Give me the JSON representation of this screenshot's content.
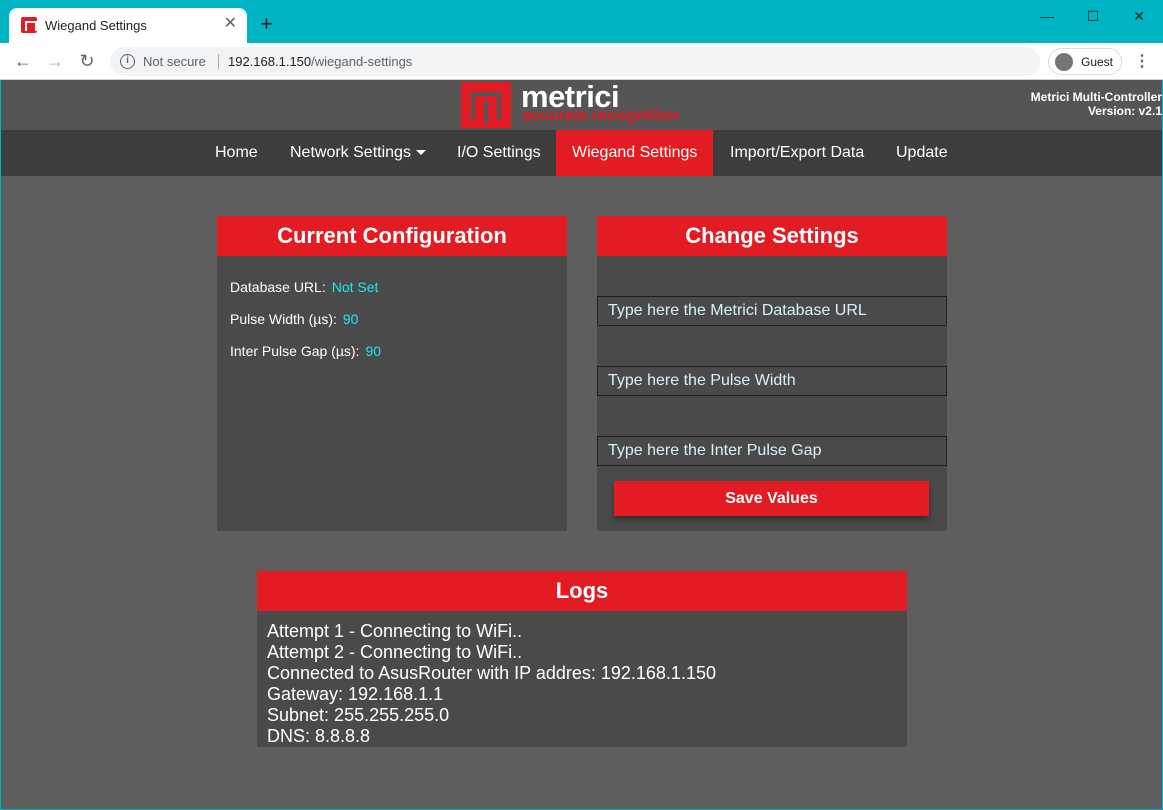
{
  "browser": {
    "tab_title": "Wiegand Settings",
    "new_tab_symbol": "+",
    "close_symbol": "✕",
    "security_label": "Not secure",
    "url_host": "192.168.1.150",
    "url_path": "/wiegand-settings",
    "profile_label": "Guest"
  },
  "header": {
    "brand_name": "metrici",
    "brand_tagline": "accurate recognition",
    "product_name": "Metrici Multi-Controller",
    "version": "Version: v2.1"
  },
  "nav": {
    "items": [
      {
        "label": "Home"
      },
      {
        "label": "Network Settings"
      },
      {
        "label": "I/O Settings"
      },
      {
        "label": "Wiegand Settings"
      },
      {
        "label": "Import/Export Data"
      },
      {
        "label": "Update"
      }
    ],
    "active": "Wiegand Settings"
  },
  "current_config": {
    "title": "Current Configuration",
    "rows": [
      {
        "label": "Database URL:",
        "value": "Not Set"
      },
      {
        "label": "Pulse Width (µs):",
        "value": "90"
      },
      {
        "label": "Inter Pulse Gap (µs):",
        "value": "90"
      }
    ]
  },
  "change_settings": {
    "title": "Change Settings",
    "db_url_placeholder": "Type here the Metrici Database URL",
    "pulse_width_placeholder": "Type here the Pulse Width",
    "pulse_gap_placeholder": "Type here the Inter Pulse Gap",
    "save_label": "Save Values"
  },
  "logs": {
    "title": "Logs",
    "lines": [
      "Attempt 1 - Connecting to WiFi..",
      "Attempt 2 - Connecting to WiFi..",
      "Connected to AsusRouter with IP addres: 192.168.1.150",
      "Gateway: 192.168.1.1",
      "Subnet: 255.255.255.0",
      "DNS: 8.8.8.8"
    ]
  },
  "colors": {
    "accent": "#e31b23",
    "value_text": "#1de9f0",
    "page_bg": "#5e5e5e",
    "card_bg": "#4a4a4a",
    "chrome": "#00b5c3"
  }
}
